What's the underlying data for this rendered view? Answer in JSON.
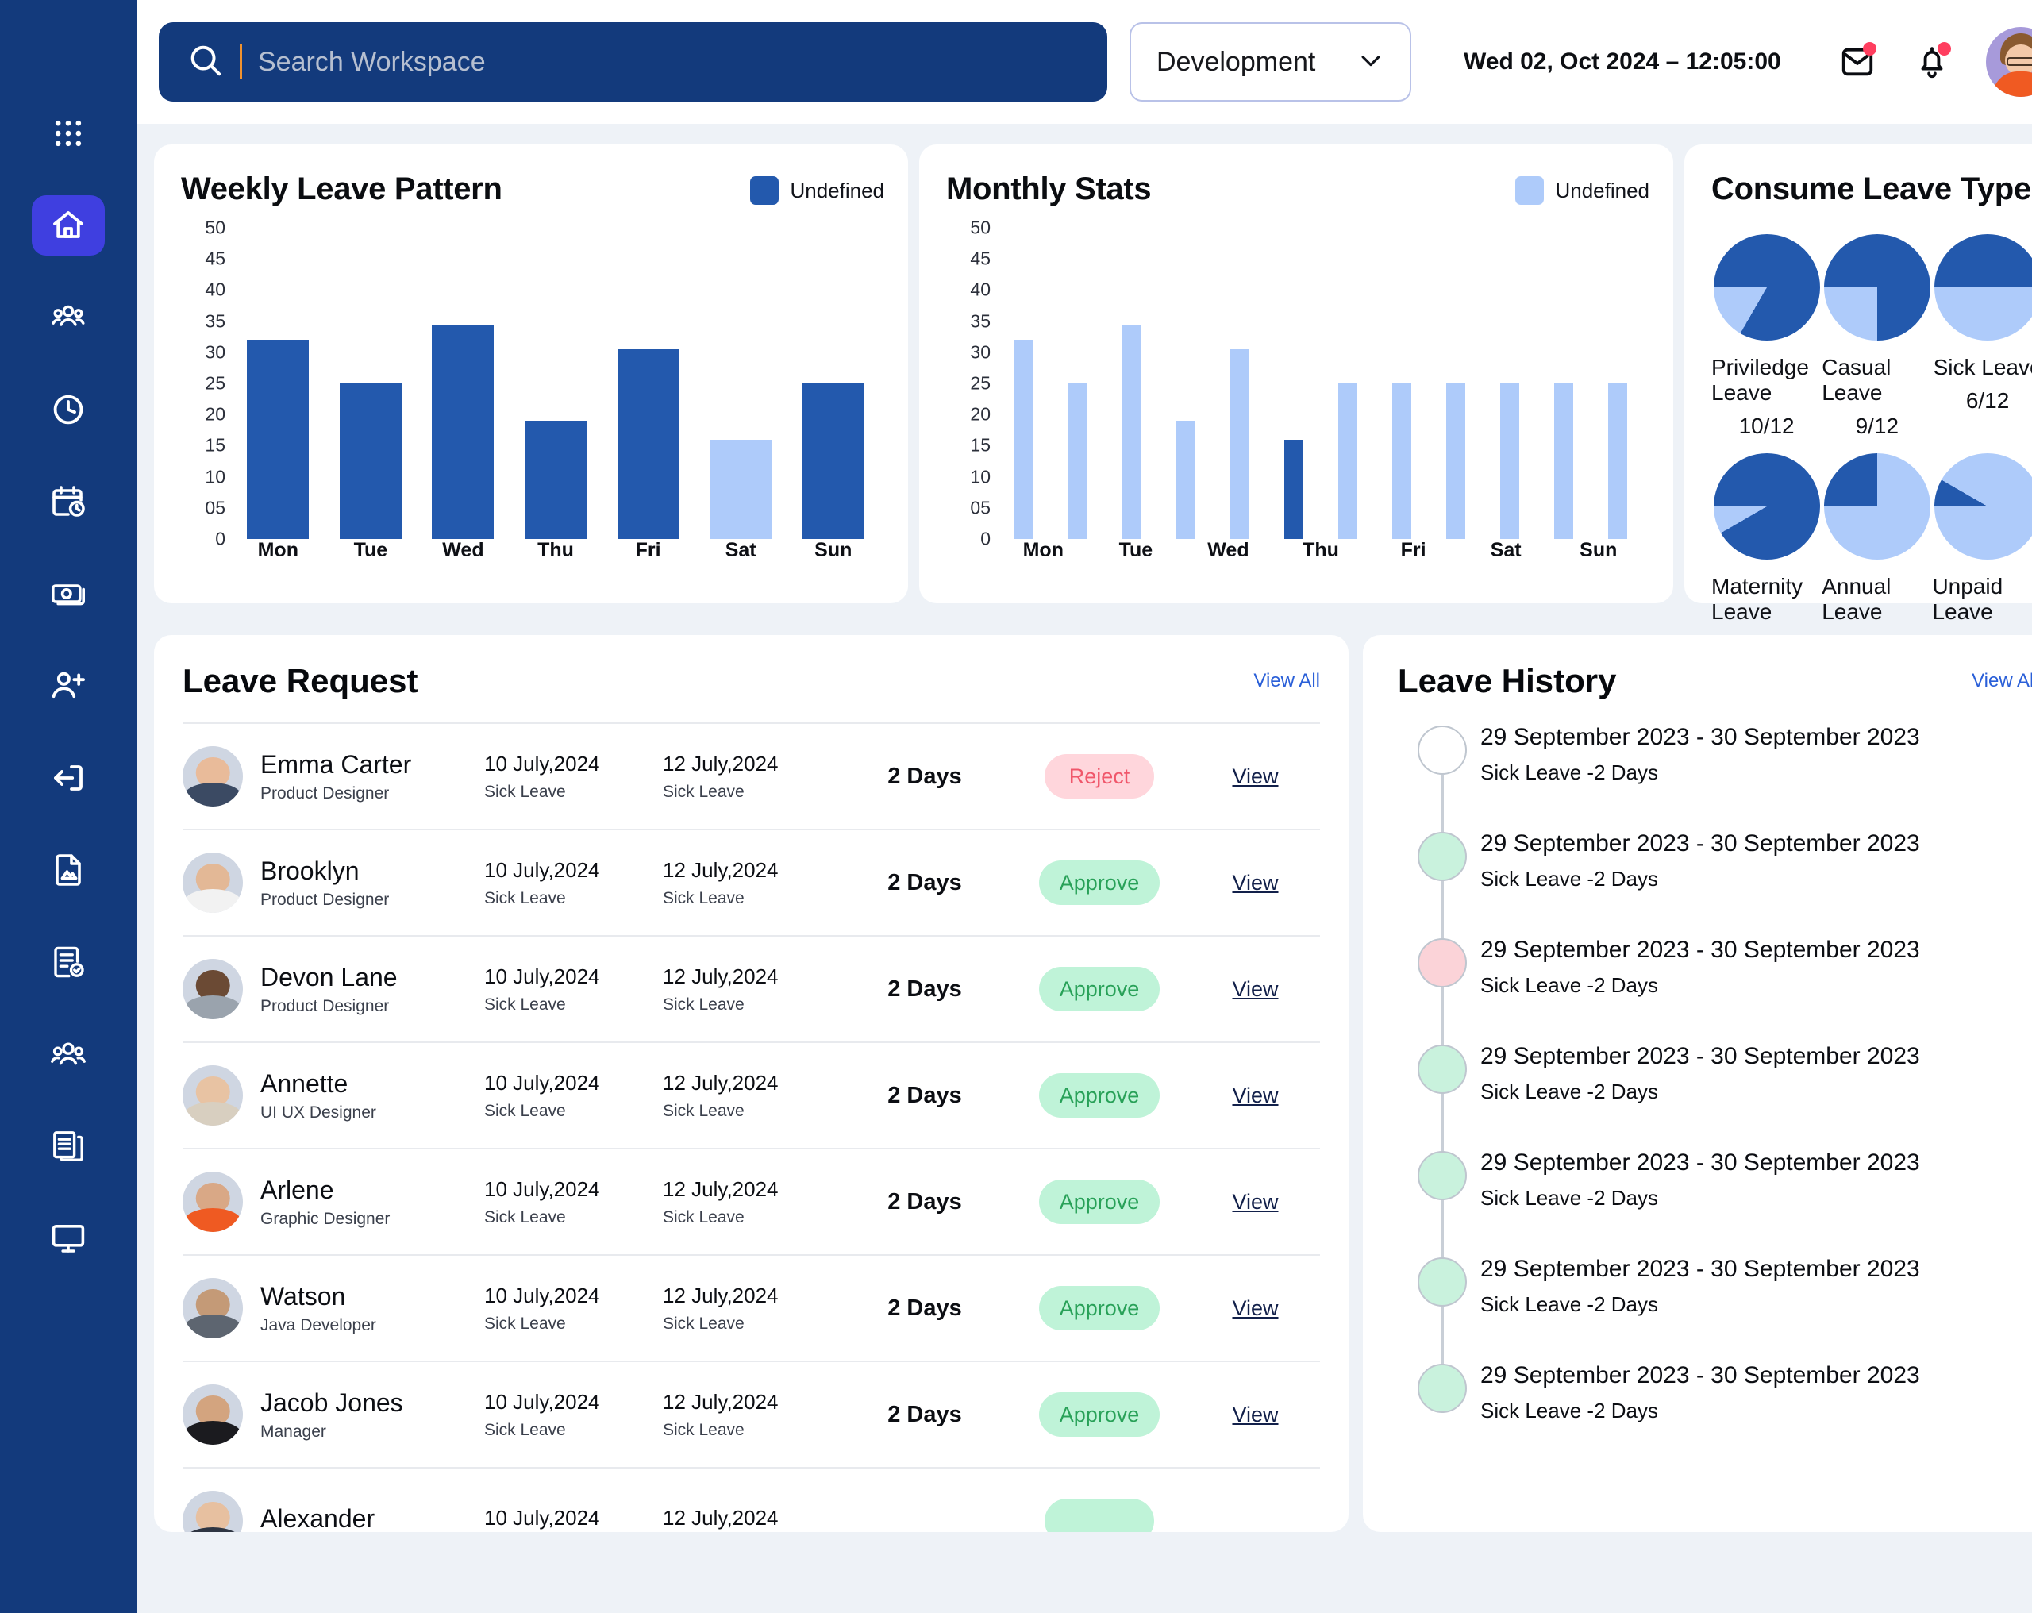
{
  "topbar": {
    "search_placeholder": "Search Workspace",
    "search_value": "",
    "department": "Development",
    "datetime": "Wed 02, Oct 2024 – 12:05:00"
  },
  "sidebar": {
    "items": [
      {
        "name": "apps-grid-icon",
        "active": false
      },
      {
        "name": "home-icon",
        "active": true
      },
      {
        "name": "people-group-icon",
        "active": false
      },
      {
        "name": "clock-icon",
        "active": false
      },
      {
        "name": "calendar-clock-icon",
        "active": false
      },
      {
        "name": "money-icon",
        "active": false
      },
      {
        "name": "user-add-icon",
        "active": false
      },
      {
        "name": "logout-icon",
        "active": false
      },
      {
        "name": "file-image-icon",
        "active": false
      },
      {
        "name": "checklist-icon",
        "active": false
      },
      {
        "name": "team-icon",
        "active": false
      },
      {
        "name": "documents-icon",
        "active": false
      },
      {
        "name": "monitor-icon",
        "active": false
      }
    ]
  },
  "chart_data": [
    {
      "type": "bar",
      "title": "Weekly Leave Pattern",
      "legend": [
        "Undefined"
      ],
      "legend_position": "top-right",
      "legend_color": "#2359ad",
      "categories": [
        "Mon",
        "Tue",
        "Wed",
        "Thu",
        "Fri",
        "Sat",
        "Sun"
      ],
      "values": [
        32,
        25,
        34.5,
        19,
        30.5,
        16,
        25
      ],
      "colors": [
        "#2359ad",
        "#2359ad",
        "#2359ad",
        "#2359ad",
        "#2359ad",
        "#aecbfa",
        "#2359ad"
      ],
      "ylim": [
        0,
        50
      ],
      "yticks": [
        "50",
        "45",
        "40",
        "35",
        "30",
        "25",
        "20",
        "15",
        "10",
        "05",
        "0"
      ],
      "xlabel": "",
      "ylabel": "",
      "grid": false
    },
    {
      "type": "bar",
      "title": "Monthly Stats",
      "legend": [
        "Undefined"
      ],
      "legend_position": "top-right",
      "legend_color": "#aecbfa",
      "categories": [
        "Mon",
        "Tue",
        "Wed",
        "Thu",
        "Fri",
        "Sat",
        "Sun"
      ],
      "bar_count": 12,
      "values": [
        32,
        25,
        34.5,
        19,
        30.5,
        16,
        25,
        25,
        25,
        25,
        25,
        25
      ],
      "colors": [
        "#aecbfa",
        "#aecbfa",
        "#aecbfa",
        "#aecbfa",
        "#aecbfa",
        "#2359ad",
        "#aecbfa",
        "#aecbfa",
        "#aecbfa",
        "#aecbfa",
        "#aecbfa",
        "#aecbfa"
      ],
      "ylim": [
        0,
        50
      ],
      "yticks": [
        "50",
        "45",
        "40",
        "35",
        "30",
        "25",
        "20",
        "15",
        "10",
        "05",
        "0"
      ],
      "xlabel": "",
      "ylabel": "",
      "grid": false
    },
    {
      "type": "pie",
      "title": "Consume Leave Type",
      "denominator": 12,
      "colors": {
        "used": "#2359ad",
        "remaining": "#aecbfa"
      },
      "slices": [
        {
          "label": "Priviledge Leave",
          "value": "10/12",
          "used": 10,
          "total": 12
        },
        {
          "label": "Casual Leave",
          "value": "9/12",
          "used": 9,
          "total": 12
        },
        {
          "label": "Sick Leave",
          "value": "6/12",
          "used": 6,
          "total": 12
        },
        {
          "label": "Maternity Leave",
          "value": "11/12",
          "used": 11,
          "total": 12
        },
        {
          "label": "Annual Leave",
          "value": "3/12",
          "used": 3,
          "total": 12
        },
        {
          "label": "Unpaid Leave",
          "value": "1/12",
          "used": 1,
          "total": 12
        }
      ]
    }
  ],
  "leave_request": {
    "title": "Leave Request",
    "view_all": "View All",
    "view_label": "View",
    "rows": [
      {
        "name": "Emma Carter",
        "role": "Product Designer",
        "from_date": "10 July,2024",
        "from_type": "Sick Leave",
        "to_date": "12 July,2024",
        "to_type": "Sick Leave",
        "days": "2 Days",
        "status": "Reject",
        "status_kind": "reject",
        "skin": "#e9bb9a",
        "cloth": "#3b4a63"
      },
      {
        "name": "Brooklyn",
        "role": "Product Designer",
        "from_date": "10 July,2024",
        "from_type": "Sick Leave",
        "to_date": "12 July,2024",
        "to_type": "Sick Leave",
        "days": "2 Days",
        "status": "Approve",
        "status_kind": "approve",
        "skin": "#e3b896",
        "cloth": "#f2f2f2"
      },
      {
        "name": "Devon Lane",
        "role": "Product Designer",
        "from_date": "10 July,2024",
        "from_type": "Sick Leave",
        "to_date": "12 July,2024",
        "to_type": "Sick Leave",
        "days": "2 Days",
        "status": "Approve",
        "status_kind": "approve",
        "skin": "#6b4a34",
        "cloth": "#9aa3ad"
      },
      {
        "name": "Annette",
        "role": "UI UX Designer",
        "from_date": "10 July,2024",
        "from_type": "Sick Leave",
        "to_date": "12 July,2024",
        "to_type": "Sick Leave",
        "days": "2 Days",
        "status": "Approve",
        "status_kind": "approve",
        "skin": "#e8c3a3",
        "cloth": "#d8cfc0"
      },
      {
        "name": "Arlene",
        "role": "Graphic Designer",
        "from_date": "10 July,2024",
        "from_type": "Sick Leave",
        "to_date": "12 July,2024",
        "to_type": "Sick Leave",
        "days": "2 Days",
        "status": "Approve",
        "status_kind": "approve",
        "skin": "#d9a886",
        "cloth": "#ef5a22"
      },
      {
        "name": "Watson",
        "role": "Java Developer",
        "from_date": "10 July,2024",
        "from_type": "Sick Leave",
        "to_date": "12 July,2024",
        "to_type": "Sick Leave",
        "days": "2 Days",
        "status": "Approve",
        "status_kind": "approve",
        "skin": "#c49a77",
        "cloth": "#5d6570"
      },
      {
        "name": "Jacob Jones",
        "role": "Manager",
        "from_date": "10 July,2024",
        "from_type": "Sick Leave",
        "to_date": "12 July,2024",
        "to_type": "Sick Leave",
        "days": "2 Days",
        "status": "Approve",
        "status_kind": "approve",
        "skin": "#d3a47f",
        "cloth": "#1b1b1f"
      },
      {
        "name": "Alexander",
        "role": "",
        "from_date": "10 July,2024",
        "from_type": "",
        "to_date": "12 July,2024",
        "to_type": "",
        "days": "",
        "status": "",
        "status_kind": "approve",
        "skin": "#e7c0a0",
        "cloth": "#2e3542"
      }
    ]
  },
  "leave_history": {
    "title": "Leave History",
    "view_all": "View All",
    "rows": [
      {
        "date_range": "29 September 2023 - 30 September 2023",
        "detail": "Sick Leave -2 Days",
        "dot": "#ffffff"
      },
      {
        "date_range": "29 September 2023 - 30 September 2023",
        "detail": "Sick Leave -2 Days",
        "dot": "#c9f2dd"
      },
      {
        "date_range": "29 September 2023 - 30 September 2023",
        "detail": "Sick Leave -2 Days",
        "dot": "#fbd3d8"
      },
      {
        "date_range": "29 September 2023 - 30 September 2023",
        "detail": "Sick Leave -2 Days",
        "dot": "#c9f2dd"
      },
      {
        "date_range": "29 September 2023 - 30 September 2023",
        "detail": "Sick Leave -2 Days",
        "dot": "#c9f2dd"
      },
      {
        "date_range": "29 September 2023 - 30 September 2023",
        "detail": "Sick Leave -2 Days",
        "dot": "#c9f2dd"
      },
      {
        "date_range": "29 September 2023 - 30 September 2023",
        "detail": "Sick Leave -2 Days",
        "dot": "#c9f2dd"
      }
    ]
  },
  "colors": {
    "sidebar": "#133a7c",
    "sidebar_active": "#3f3fe0",
    "accent_dark_blue": "#2359ad",
    "accent_light_blue": "#aecbfa",
    "approve_bg": "#bff3d8",
    "approve_text": "#28a158",
    "reject_bg": "#ffd6dc",
    "reject_text": "#f0576b",
    "link": "#2a5fd8",
    "page_bg": "#eef2f7"
  }
}
